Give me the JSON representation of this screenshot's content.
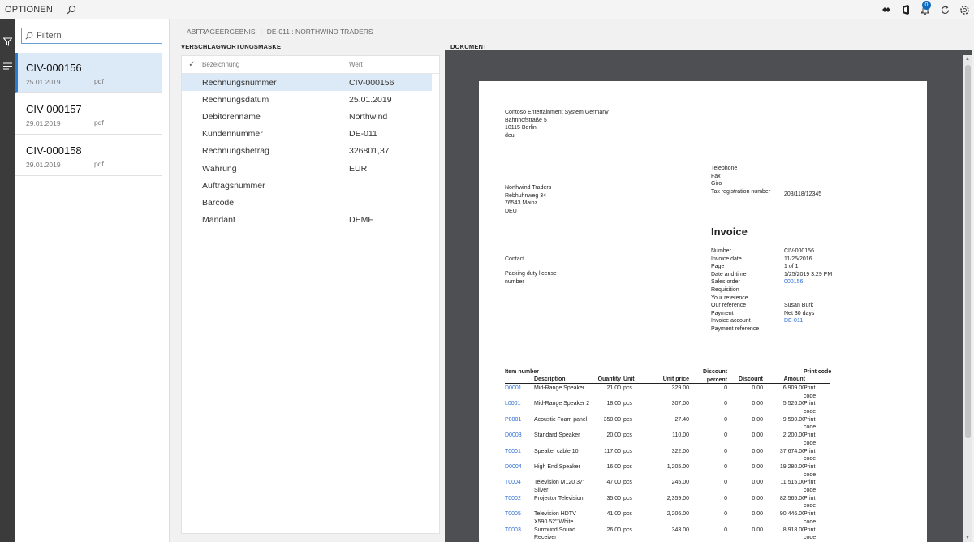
{
  "topbar": {
    "options_label": "OPTIONEN",
    "notification_count": "0"
  },
  "filter": {
    "placeholder": "Filtern"
  },
  "documents": [
    {
      "name": "CIV-000156",
      "date": "25.01.2019",
      "type": "pdf"
    },
    {
      "name": "CIV-000157",
      "date": "29.01.2019",
      "type": "pdf"
    },
    {
      "name": "CIV-000158",
      "date": "29.01.2019",
      "type": "pdf"
    }
  ],
  "breadcrumb": {
    "part1": "ABFRAGEERGEBNIS",
    "sep": "|",
    "part2": "DE-011 : NORTHWIND TRADERS"
  },
  "sections": {
    "mask": "VERSCHLAGWORTUNGSMASKE",
    "document": "DOKUMENT"
  },
  "form": {
    "col_name": "Bezeichnung",
    "col_value": "Wert",
    "rows": [
      {
        "label": "Rechnungsnummer",
        "value": "CIV-000156"
      },
      {
        "label": "Rechnungsdatum",
        "value": "25.01.2019"
      },
      {
        "label": "Debitorenname",
        "value": "Northwind"
      },
      {
        "label": "Kundennummer",
        "value": "DE-011"
      },
      {
        "label": "Rechnungsbetrag",
        "value": "326801,37"
      },
      {
        "label": "Währung",
        "value": "EUR"
      },
      {
        "label": "Auftragsnummer",
        "value": ""
      },
      {
        "label": "Barcode",
        "value": ""
      },
      {
        "label": "Mandant",
        "value": "DEMF"
      }
    ]
  },
  "invoice": {
    "sender": [
      "Contoso Entertainment System Germany",
      "Bahnhofstraße 5",
      "10115 Berlin",
      "deu"
    ],
    "contact_block": [
      "Telephone",
      "Fax",
      "Giro",
      "Tax registration number"
    ],
    "tax_number": "203/118/12345",
    "recipient": [
      "Northwind Traders",
      "Rebhuhnweg 34",
      "76543 Mainz",
      "DEU"
    ],
    "title": "Invoice",
    "contact_label": "Contact",
    "packing_label": [
      "Packing duty license",
      "number"
    ],
    "meta": [
      {
        "k": "Number",
        "v": "CIV-000156"
      },
      {
        "k": "Invoice date",
        "v": "11/25/2016"
      },
      {
        "k": "Page",
        "v": "1      of    1"
      },
      {
        "k": "Date and time",
        "v": "1/25/2019 3:29 PM"
      },
      {
        "k": "Sales order",
        "v": "000156"
      },
      {
        "k": "Requisition",
        "v": ""
      },
      {
        "k": "Your reference",
        "v": ""
      },
      {
        "k": "Our reference",
        "v": "Susan Burk"
      },
      {
        "k": "Payment",
        "v": "Net 30 days"
      },
      {
        "k": "Invoice account",
        "v": "DE-011"
      },
      {
        "k": "Payment reference",
        "v": ""
      }
    ],
    "columns": {
      "item": "Item number",
      "description": "Description",
      "quantity": "Quantity",
      "unit": "Unit",
      "unit_price": "Unit price",
      "discount_pct": "Discount percent",
      "discount": "Discount",
      "amount": "Amount",
      "print_code": "Print code"
    },
    "lines": [
      {
        "item": "D0001",
        "desc": "Mid-Range Speaker",
        "qty": "21.00",
        "unit": "pcs",
        "price": "329.00",
        "dpct": "0",
        "disc": "0.00",
        "amount": "6,909.00",
        "pc": "Print code"
      },
      {
        "item": "L0001",
        "desc": "Mid-Range Speaker 2",
        "qty": "18.00",
        "unit": "pcs",
        "price": "307.00",
        "dpct": "0",
        "disc": "0.00",
        "amount": "5,526.00",
        "pc": "Print code"
      },
      {
        "item": "P0001",
        "desc": "Acoustic Foam panel",
        "qty": "350.00",
        "unit": "pcs",
        "price": "27.40",
        "dpct": "0",
        "disc": "0.00",
        "amount": "9,590.00",
        "pc": "Print code"
      },
      {
        "item": "D0003",
        "desc": "Standard Speaker",
        "qty": "20.00",
        "unit": "pcs",
        "price": "110.00",
        "dpct": "0",
        "disc": "0.00",
        "amount": "2,200.00",
        "pc": "Print code"
      },
      {
        "item": "T0001",
        "desc": "Speaker cable 10",
        "qty": "117.00",
        "unit": "pcs",
        "price": "322.00",
        "dpct": "0",
        "disc": "0.00",
        "amount": "37,674.00",
        "pc": "Print code"
      },
      {
        "item": "D0004",
        "desc": "High End Speaker",
        "qty": "16.00",
        "unit": "pcs",
        "price": "1,205.00",
        "dpct": "0",
        "disc": "0.00",
        "amount": "19,280.00",
        "pc": "Print code"
      },
      {
        "item": "T0004",
        "desc": "Television M120 37\" Silver",
        "qty": "47.00",
        "unit": "pcs",
        "price": "245.00",
        "dpct": "0",
        "disc": "0.00",
        "amount": "11,515.00",
        "pc": "Print code"
      },
      {
        "item": "T0002",
        "desc": "Projector Television",
        "qty": "35.00",
        "unit": "pcs",
        "price": "2,359.00",
        "dpct": "0",
        "disc": "0.00",
        "amount": "82,565.00",
        "pc": "Print code"
      },
      {
        "item": "T0005",
        "desc": "Television HDTV X590 52\" White",
        "qty": "41.00",
        "unit": "pcs",
        "price": "2,206.00",
        "dpct": "0",
        "disc": "0.00",
        "amount": "90,446.00",
        "pc": "Print code"
      },
      {
        "item": "T0003",
        "desc": "Surround Sound Receiver",
        "qty": "26.00",
        "unit": "pcs",
        "price": "343.00",
        "dpct": "0",
        "disc": "0.00",
        "amount": "8,918.00",
        "pc": "Print code"
      }
    ]
  }
}
